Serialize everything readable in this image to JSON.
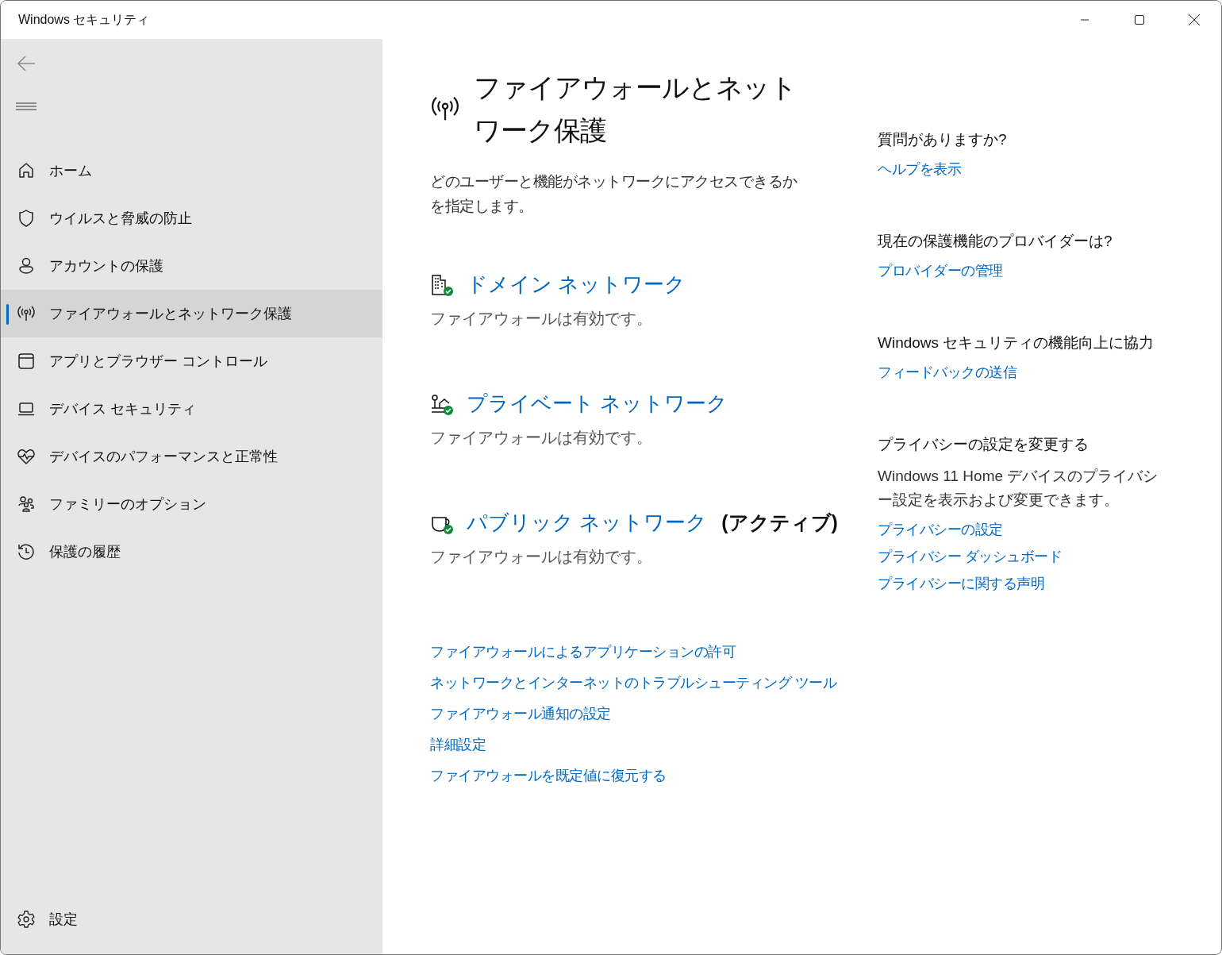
{
  "window": {
    "title": "Windows セキュリティ"
  },
  "sidebar": {
    "items": [
      {
        "kind": "home",
        "label": "ホーム",
        "selected": false
      },
      {
        "kind": "shield",
        "label": "ウイルスと脅威の防止",
        "selected": false
      },
      {
        "kind": "person",
        "label": "アカウントの保護",
        "selected": false
      },
      {
        "kind": "antenna",
        "label": "ファイアウォールとネットワーク保護",
        "selected": true
      },
      {
        "kind": "browser",
        "label": "アプリとブラウザー コントロール",
        "selected": false
      },
      {
        "kind": "laptop",
        "label": "デバイス セキュリティ",
        "selected": false
      },
      {
        "kind": "heart",
        "label": "デバイスのパフォーマンスと正常性",
        "selected": false
      },
      {
        "kind": "family",
        "label": "ファミリーのオプション",
        "selected": false
      },
      {
        "kind": "history",
        "label": "保護の履歴",
        "selected": false
      }
    ],
    "settings": {
      "label": "設定"
    }
  },
  "page": {
    "title": "ファイアウォールとネットワーク保護",
    "description": "どのユーザーと機能がネットワークにアクセスできるかを指定します。",
    "networks": [
      {
        "kind": "domain",
        "name": "ドメイン ネットワーク",
        "status": "ファイアウォールは有効です。",
        "enabled": true
      },
      {
        "kind": "private",
        "name": "プライベート ネットワーク",
        "status": "ファイアウォールは有効です。",
        "enabled": true
      },
      {
        "kind": "public",
        "name": "パブリック ネットワーク",
        "badge": "(アクティブ)",
        "status": "ファイアウォールは有効です。",
        "enabled": true
      }
    ],
    "links": [
      "ファイアウォールによるアプリケーションの許可",
      "ネットワークとインターネットのトラブルシューティング ツール",
      "ファイアウォール通知の設定",
      "詳細設定",
      "ファイアウォールを既定値に復元する"
    ]
  },
  "aside": [
    {
      "heading": "質問がありますか?",
      "links": [
        "ヘルプを表示"
      ]
    },
    {
      "heading": "現在の保護機能のプロバイダーは?",
      "links": [
        "プロバイダーの管理"
      ]
    },
    {
      "heading": "Windows セキュリティの機能向上に協力",
      "links": [
        "フィードバックの送信"
      ]
    },
    {
      "heading": "プライバシーの設定を変更する",
      "text": "Windows 11 Home デバイスのプライバシー設定を表示および変更できます。",
      "links": [
        "プライバシーの設定",
        "プライバシー ダッシュボード",
        "プライバシーに関する声明"
      ]
    }
  ]
}
